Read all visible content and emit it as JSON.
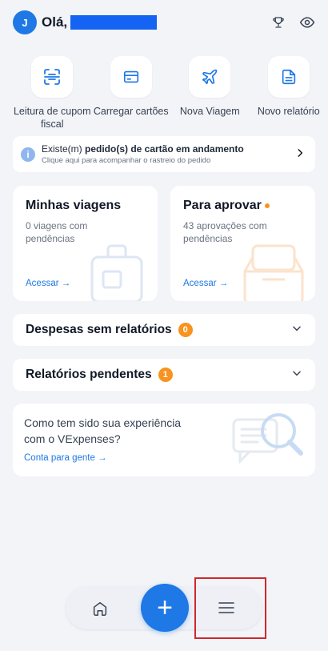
{
  "header": {
    "avatar_initial": "J",
    "greeting": "Olá,"
  },
  "quick_actions": [
    {
      "label": "Leitura de cupom fiscal",
      "icon": "scan-receipt-icon"
    },
    {
      "label": "Carregar cartões",
      "icon": "card-icon"
    },
    {
      "label": "Nova Viagem",
      "icon": "airplane-icon"
    },
    {
      "label": "Novo relatório",
      "icon": "document-icon"
    }
  ],
  "banner": {
    "prefix": "Existe(m) ",
    "bold": "pedido(s) de cartão em andamento",
    "subtitle": "Clique aqui para acompanhar o rastreio do pedido"
  },
  "cards": {
    "trips": {
      "title": "Minhas viagens",
      "subtitle": "0 viagens com pendências",
      "link": "Acessar →"
    },
    "approve": {
      "title": "Para aprovar",
      "subtitle": "43 aprovações com pendências",
      "link": "Acessar →"
    }
  },
  "sections": {
    "expenses": {
      "title": "Despesas sem relatórios",
      "count": "0"
    },
    "reports": {
      "title": "Relatórios pendentes",
      "count": "1"
    }
  },
  "feedback": {
    "text": "Como tem sido sua experiência com o VExpenses?",
    "link": "Conta para gente →"
  },
  "nav": {
    "fab_label": "+"
  },
  "colors": {
    "primary": "#1e78e6",
    "accent": "#f7931e",
    "background": "#f2f4f8",
    "highlight": "#d0272d"
  }
}
